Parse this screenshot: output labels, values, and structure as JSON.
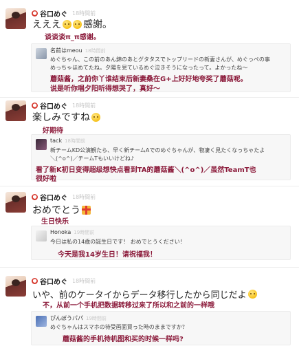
{
  "posts": [
    {
      "author": "谷口めぐ",
      "time": "18時間前",
      "text": "えええ",
      "text_after": "感謝。",
      "translation": "谈谈谈π_π感谢。",
      "reply": {
        "author": "名前はmeou",
        "time": "18時間前",
        "line1": "めぐちゃん、この前のあん錦のあとグタタスでトップリードの新妻さんが、めぐっぺの事",
        "line2": "めっちゃほめてたね。夕陽を見ているめぐ泣きそうになったって。よかったね〜",
        "translation1": "蘑菇酱，之前你丫谁结束后新妻桑在G+上好好地夸奖了蘑菇呢。",
        "translation2": "说是听你唱夕阳听得想哭了，真好～"
      }
    },
    {
      "author": "谷口めぐ",
      "time": "18時間前",
      "text": "楽しみですね",
      "translation": "好期待",
      "reply": {
        "author": "tack",
        "time": "18時間前",
        "line1": "新チームKD公演観たら、早く新チームAでのめぐちゃんが、物凄く見たくなっちゃたよ",
        "line2": "＼(^o^)／チームTもいいけどね♪",
        "translation1": "看了新K初日变得超级想快点看到TA的蘑菇酱＼(^o^)／虽然TeamT也",
        "translation2": "很好啦"
      }
    },
    {
      "author": "谷口めぐ",
      "time": "18時間前",
      "text": "おめでとう",
      "translation": "生日快乐",
      "reply": {
        "author": "Honoka",
        "time": "19時間前",
        "line1": "今日は私の14歳の誕生日です！ おめでとうください！",
        "translation1": "今天是我14岁生日！请祝福我！"
      }
    },
    {
      "author": "谷口めぐ",
      "time": "18時間前",
      "text": "いや、前のケータイからデータ移行したから同じだよ",
      "translation": "不，从前一个手机把数据转移过来了所以和之前的一样哦",
      "reply": {
        "author": "ぴんぼうパパ",
        "time": "19時間前",
        "line1": "めぐちゃんはスマホの待受画面買った時のままですか？",
        "translation1": "蘑菇酱的手机待机图和买的时候一样吗?"
      }
    }
  ],
  "colors": {
    "translation": "#8b1a3a",
    "dot": "#d6372c"
  }
}
